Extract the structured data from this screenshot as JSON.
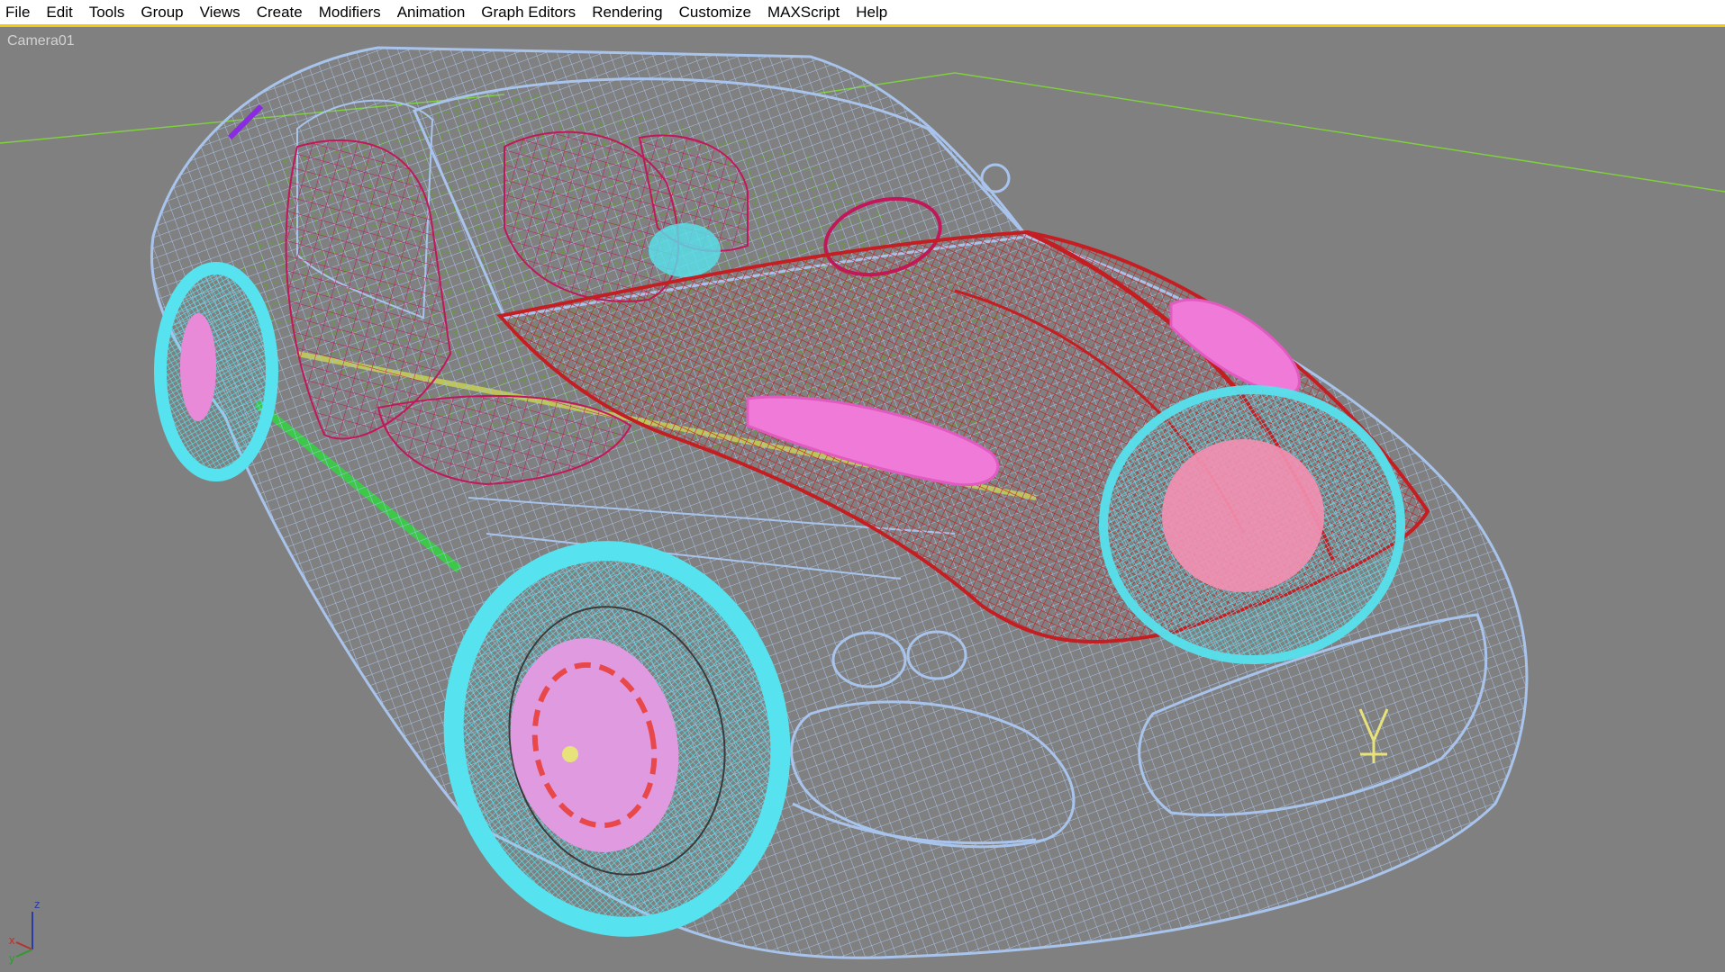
{
  "menu": [
    {
      "id": "file",
      "label": "File"
    },
    {
      "id": "edit",
      "label": "Edit"
    },
    {
      "id": "tools",
      "label": "Tools"
    },
    {
      "id": "group",
      "label": "Group"
    },
    {
      "id": "views",
      "label": "Views"
    },
    {
      "id": "create",
      "label": "Create"
    },
    {
      "id": "modifiers",
      "label": "Modifiers"
    },
    {
      "id": "animation",
      "label": "Animation"
    },
    {
      "id": "graph-editors",
      "label": "Graph Editors"
    },
    {
      "id": "rendering",
      "label": "Rendering"
    },
    {
      "id": "customize",
      "label": "Customize"
    },
    {
      "id": "maxscript",
      "label": "MAXScript"
    },
    {
      "id": "help",
      "label": "Help"
    }
  ],
  "viewport": {
    "label": "Camera01",
    "display_mode": "wireframe",
    "background_color": "#808080",
    "colors": {
      "body": "#a9c4ec",
      "hood": "#c41e23",
      "wheels": "#56e2ee",
      "rims": "#e88ad8",
      "interior": "#c2185b",
      "chassis": "#5aa51a",
      "grid": "#7fd23c",
      "logo": "#e8e27a"
    }
  },
  "axis": {
    "x": "x",
    "y": "y",
    "z": "z",
    "colors": {
      "x": "#ff4040",
      "y": "#40ff40",
      "z": "#4060ff"
    }
  }
}
